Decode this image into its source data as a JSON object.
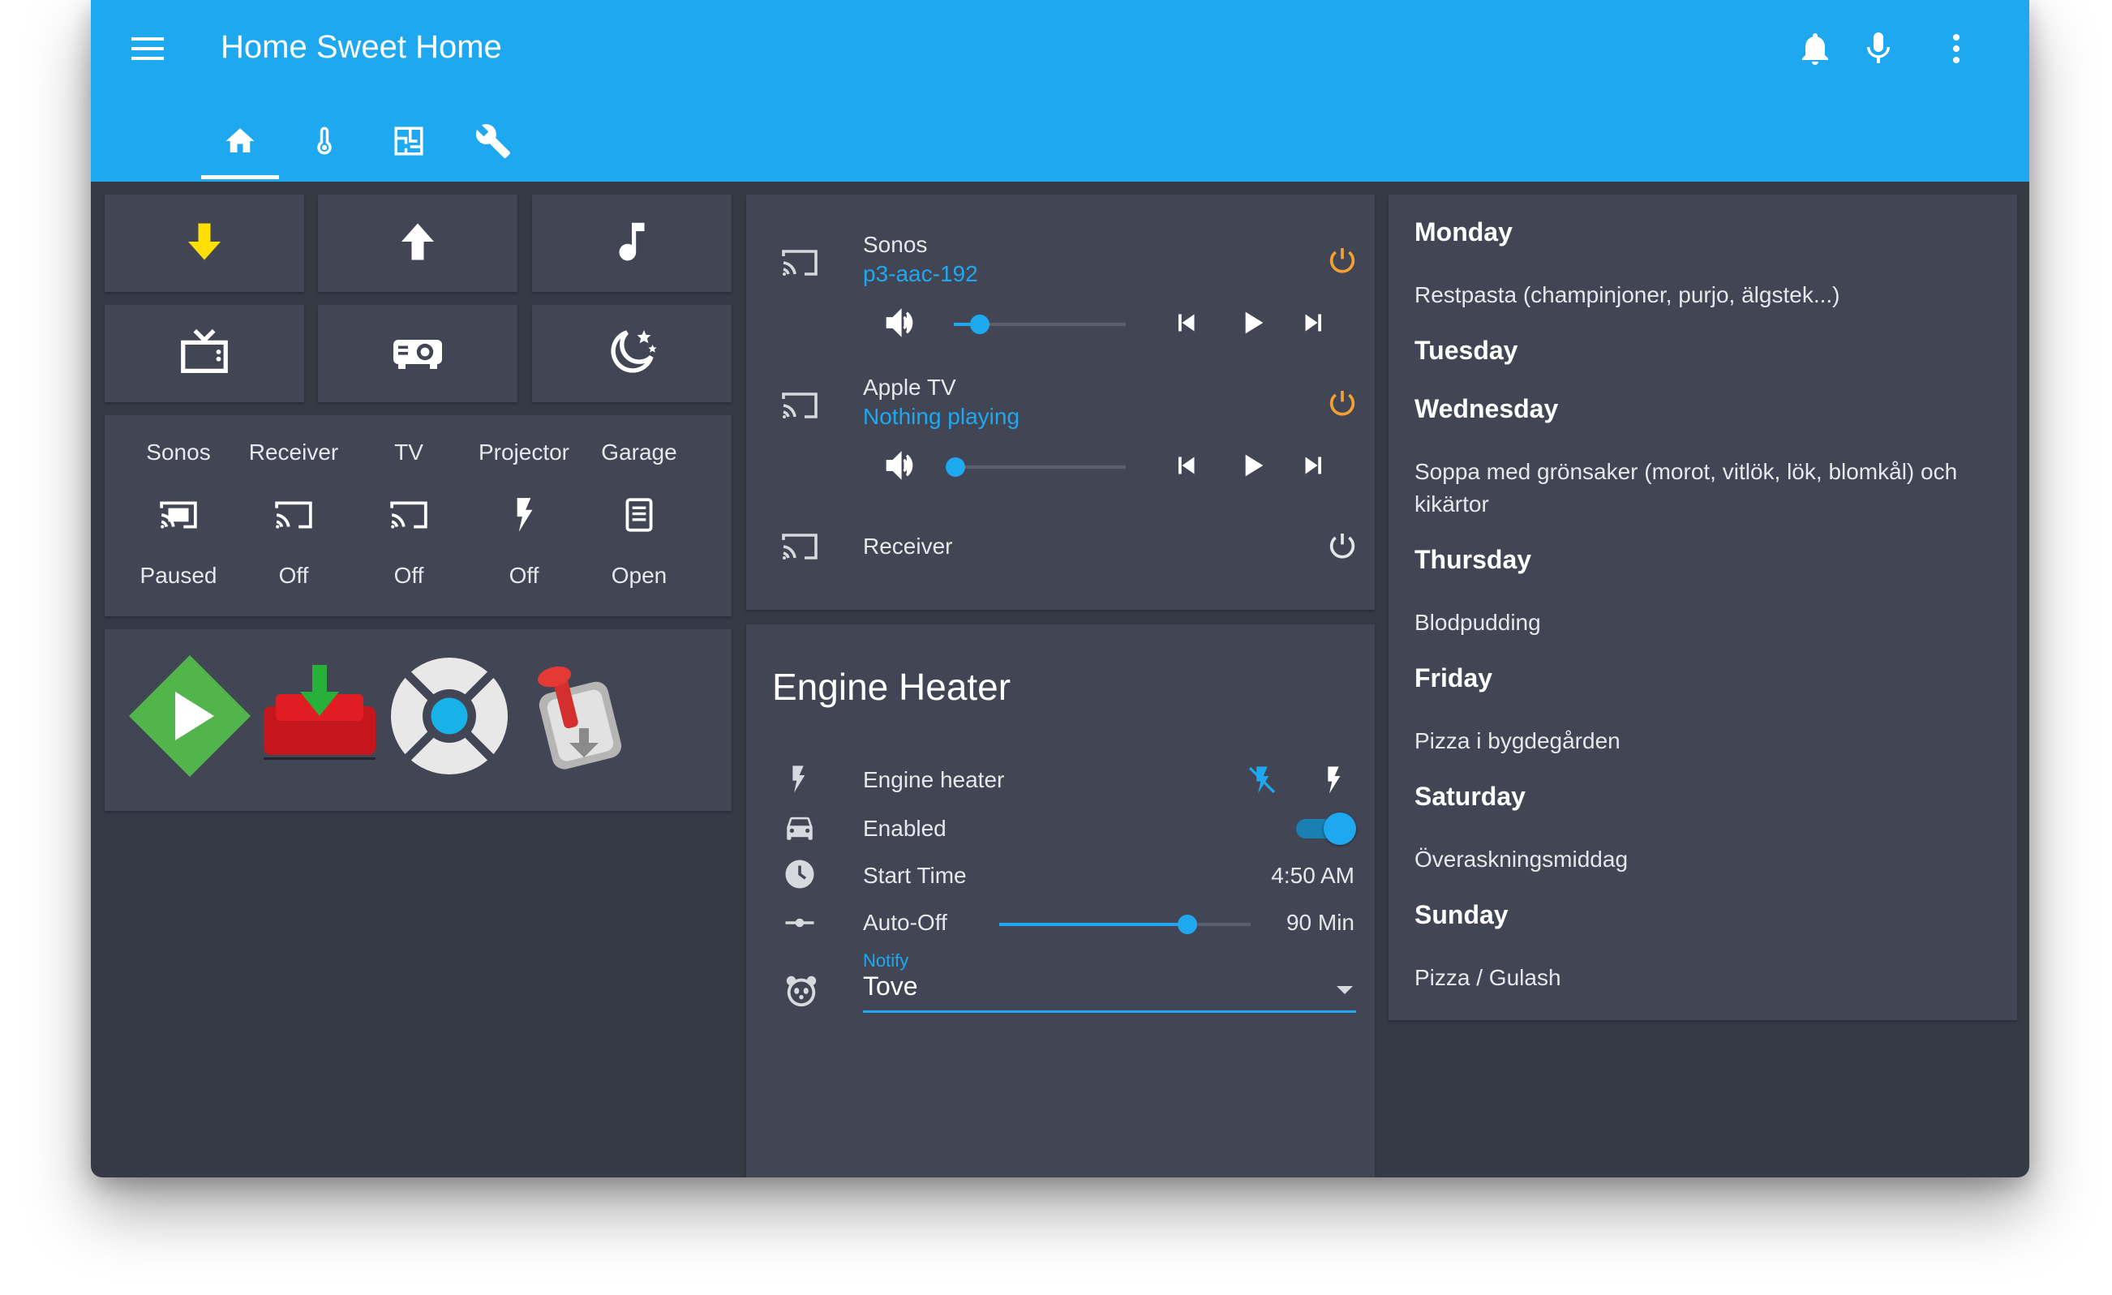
{
  "header": {
    "title": "Home Sweet Home",
    "icons": [
      "menu-icon",
      "bell-icon",
      "microphone-icon",
      "more-vert-icon"
    ],
    "tabs": [
      "home-icon",
      "thermometer-icon",
      "floorplan-icon",
      "wrench-icon"
    ],
    "active_tab": 0
  },
  "quick_buttons": [
    {
      "icon": "arrow-down-icon",
      "color": "#ffe000"
    },
    {
      "icon": "arrow-up-icon",
      "color": "#ffffff"
    },
    {
      "icon": "music-note-icon",
      "color": "#ffffff"
    },
    {
      "icon": "tv-icon",
      "color": "#ffffff"
    },
    {
      "icon": "projector-icon",
      "color": "#ffffff"
    },
    {
      "icon": "sleep-moon-icon",
      "color": "#ffffff"
    }
  ],
  "glance": [
    {
      "name": "Sonos",
      "state": "Paused",
      "icon": "cast-connected-icon"
    },
    {
      "name": "Receiver",
      "state": "Off",
      "icon": "cast-icon"
    },
    {
      "name": "TV",
      "state": "Off",
      "icon": "cast-icon"
    },
    {
      "name": "Projector",
      "state": "Off",
      "icon": "flash-icon"
    },
    {
      "name": "Garage",
      "state": "Open",
      "icon": "garage-icon"
    }
  ],
  "apps": [
    "emby-app-icon",
    "couchpotato-app-icon",
    "kodi-app-icon",
    "transmission-app-icon"
  ],
  "media": [
    {
      "name": "Sonos",
      "status": "p3-aac-192",
      "volume": 0.15,
      "power_color": "#f4a035"
    },
    {
      "name": "Apple TV",
      "status": "Nothing playing",
      "volume": 0.0,
      "power_color": "#f4a035"
    },
    {
      "name": "Receiver",
      "status": "",
      "power_color": "#e6e7ea"
    }
  ],
  "engine": {
    "title": "Engine Heater",
    "rows": {
      "heater": "Engine heater",
      "enabled": "Enabled",
      "enabled_on": true,
      "start_label": "Start Time",
      "start_value": "4:50 AM",
      "autooff_label": "Auto-Off",
      "autooff_value": "90 Min",
      "autooff_level": 0.75
    },
    "notify": {
      "label": "Notify",
      "value": "Tove"
    }
  },
  "menu": [
    {
      "day": "Monday",
      "meal": "Restpasta (champinjoner, purjo, älgstek...)"
    },
    {
      "day": "Tuesday",
      "meal": ""
    },
    {
      "day": "Wednesday",
      "meal": "Soppa med grönsaker (morot, vitlök, lök, blomkål) och kikärtor"
    },
    {
      "day": "Thursday",
      "meal": "Blodpudding"
    },
    {
      "day": "Friday",
      "meal": "Pizza i bygdegården"
    },
    {
      "day": "Saturday",
      "meal": "Överaskningsmiddag"
    },
    {
      "day": "Sunday",
      "meal": "Pizza / Gulash"
    }
  ],
  "colors": {
    "accent": "#1ea8ef",
    "background": "#363a45",
    "card": "#424654",
    "warning": "#f4a035"
  }
}
